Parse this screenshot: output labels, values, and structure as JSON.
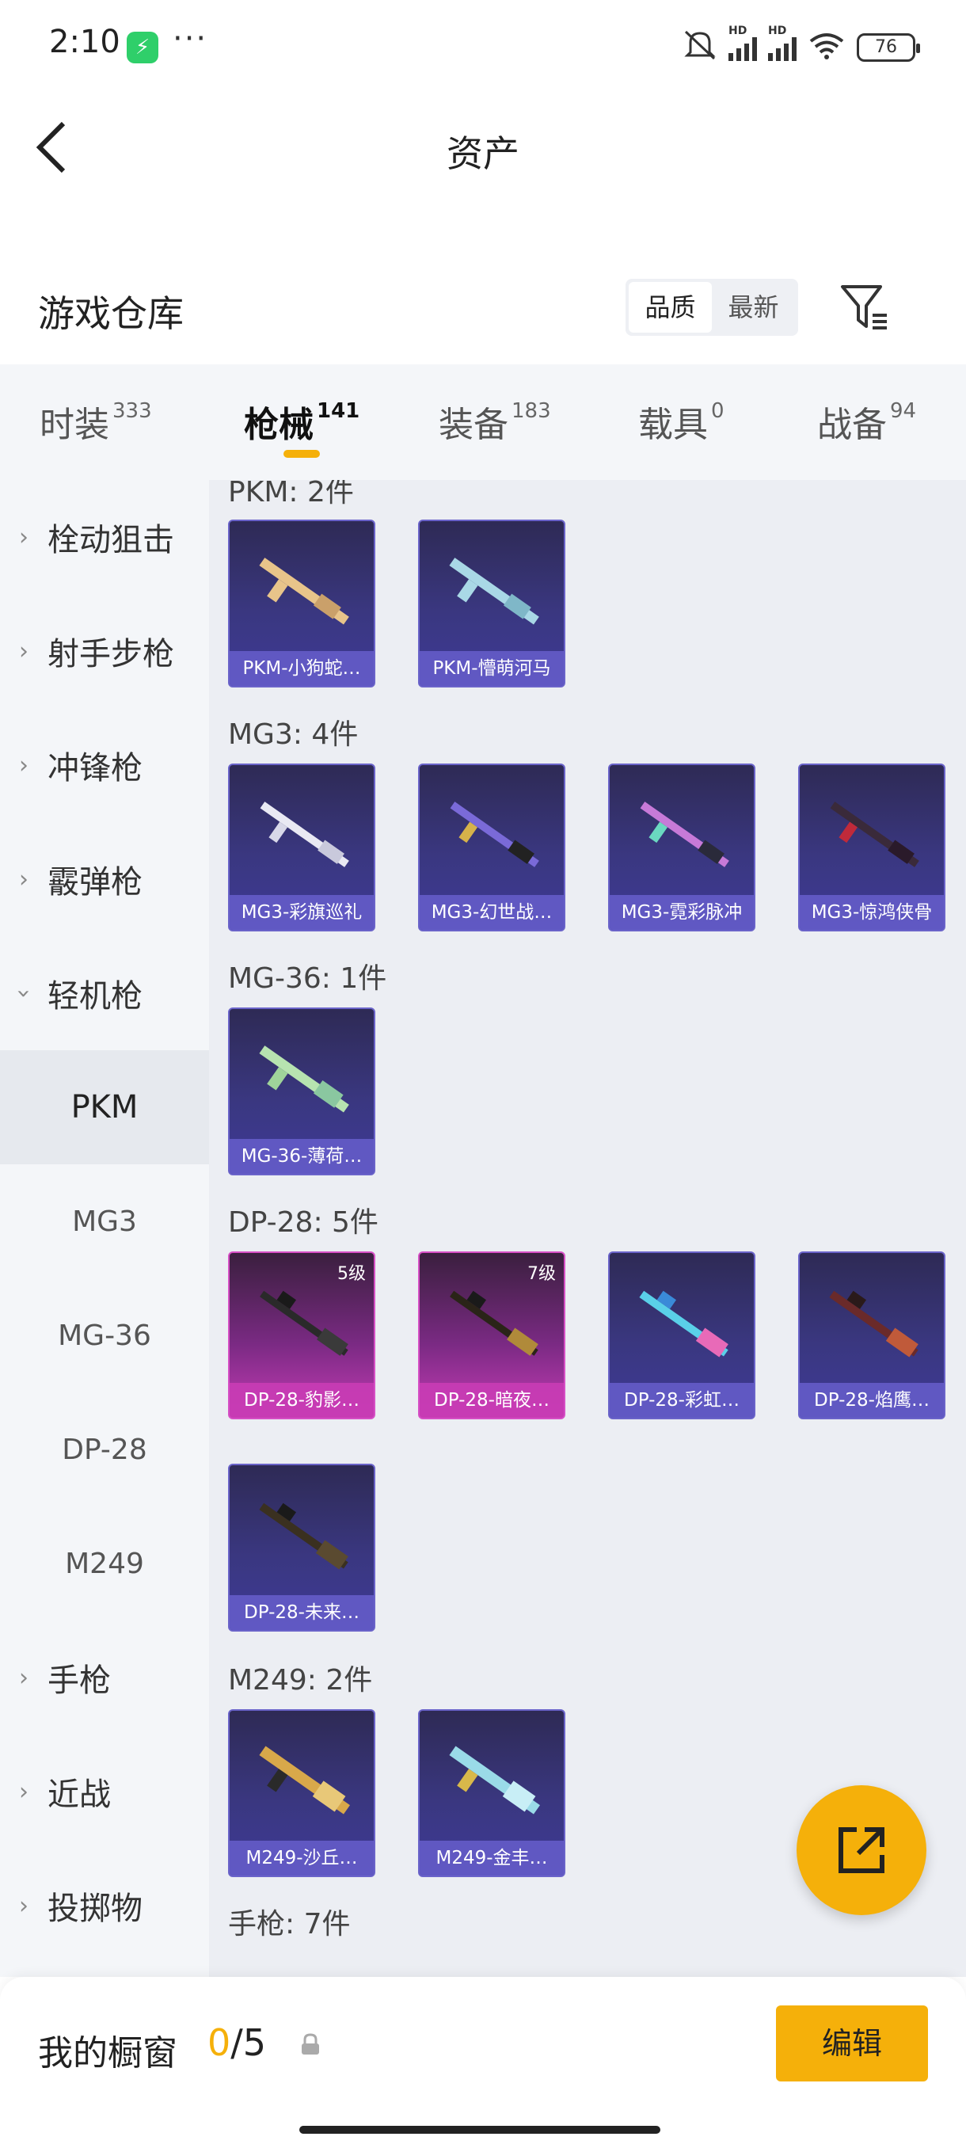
{
  "status": {
    "time": "2:10",
    "dots": "···",
    "battery": "76",
    "hd": "HD"
  },
  "header": {
    "title": "资产"
  },
  "warehouse": {
    "title": "游戏仓库",
    "sort": [
      "品质",
      "最新"
    ]
  },
  "tabs": [
    {
      "label": "时装",
      "count": "333"
    },
    {
      "label": "枪械",
      "count": "141"
    },
    {
      "label": "装备",
      "count": "183"
    },
    {
      "label": "载具",
      "count": "0"
    },
    {
      "label": "战备",
      "count": "94"
    }
  ],
  "sidebar": {
    "top": [
      "栓动狙击",
      "射手步枪",
      "冲锋枪",
      "霰弹枪"
    ],
    "expanded": "轻机枪",
    "subs": [
      "PKM",
      "MG3",
      "MG-36",
      "DP-28",
      "M249"
    ],
    "bottom": [
      "手枪",
      "近战",
      "投掷物"
    ]
  },
  "groups": [
    {
      "title": "PKM: 2件",
      "items": [
        "PKM-小狗蛇…",
        "PKM-懵萌河马"
      ]
    },
    {
      "title": "MG3: 4件",
      "items": [
        "MG3-彩旗巡礼",
        "MG3-幻世战…",
        "MG3-霓彩脉冲",
        "MG3-惊鸿侠骨"
      ]
    },
    {
      "title": "MG-36: 1件",
      "items": [
        "MG-36-薄荷…"
      ]
    },
    {
      "title": "DP-28: 5件",
      "items": [
        "DP-28-豹影…",
        "DP-28-暗夜…",
        "DP-28-彩虹…",
        "DP-28-焰鹰…",
        "DP-28-未来…"
      ],
      "levels": [
        "5级",
        "7级"
      ]
    },
    {
      "title": "M249: 2件",
      "items": [
        "M249-沙丘…",
        "M249-金丰…"
      ]
    },
    {
      "title": "手枪: 7件"
    }
  ],
  "bottom_bar": {
    "label": "我的橱窗",
    "current": "0",
    "total": "/5",
    "edit": "编辑"
  }
}
